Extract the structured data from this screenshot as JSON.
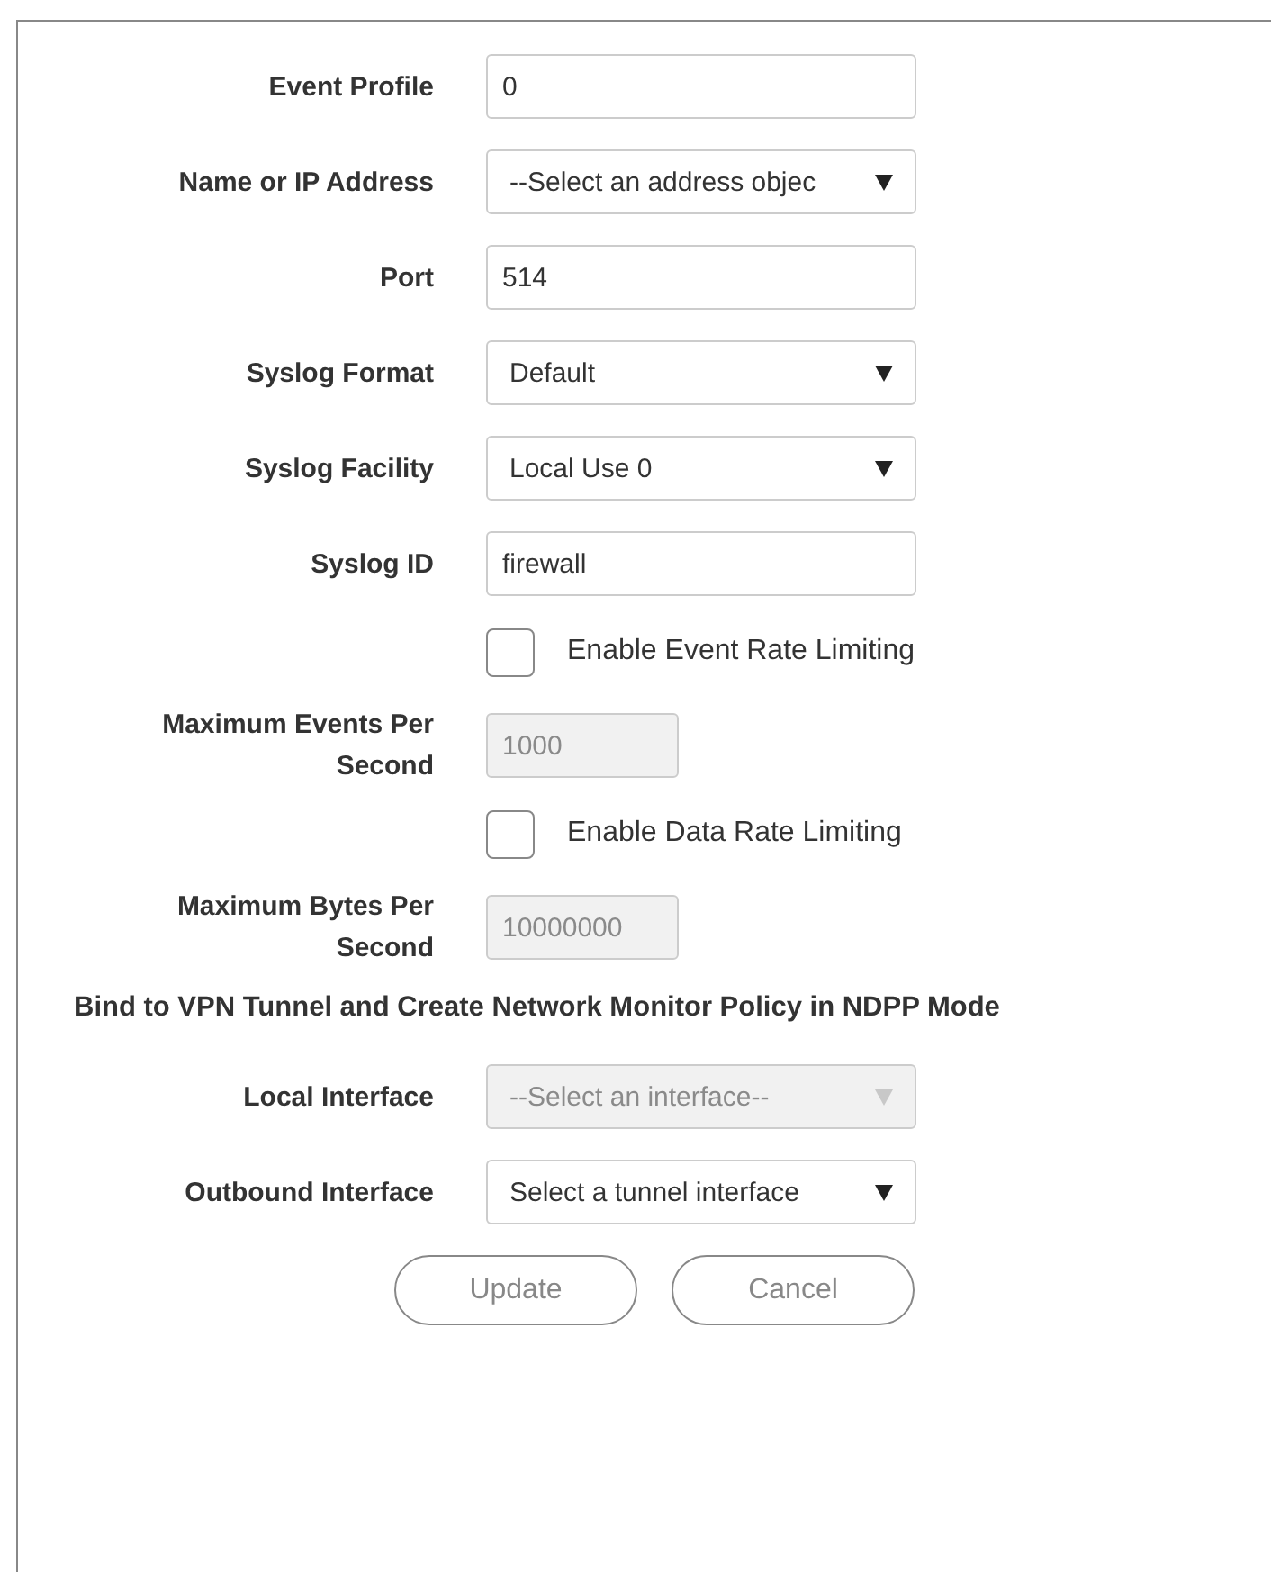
{
  "form": {
    "rows": [
      {
        "kind": "text",
        "label": "Event Profile",
        "value": "0",
        "disabled": false
      },
      {
        "kind": "select",
        "label": "Name or IP Address",
        "value": "--Select an address objec",
        "disabled": false
      },
      {
        "kind": "text",
        "label": "Port",
        "value": "514",
        "disabled": false
      },
      {
        "kind": "select",
        "label": "Syslog Format",
        "value": "Default",
        "disabled": false
      },
      {
        "kind": "select",
        "label": "Syslog Facility",
        "value": "Local Use 0",
        "disabled": false
      },
      {
        "kind": "text",
        "label": "Syslog ID",
        "value": "firewall",
        "disabled": false
      },
      {
        "kind": "checkbox",
        "label": "Enable Event Rate Limiting",
        "checked": false
      },
      {
        "kind": "short_text",
        "label": "Maximum Events Per Second",
        "value": "1000",
        "disabled": true
      },
      {
        "kind": "checkbox",
        "label": "Enable Data Rate Limiting",
        "checked": false
      },
      {
        "kind": "short_text",
        "label": "Maximum Bytes Per Second",
        "value": "10000000",
        "disabled": true
      },
      {
        "kind": "heading",
        "label": "Bind to VPN Tunnel and Create Network Monitor Policy in NDPP Mode"
      },
      {
        "kind": "select",
        "label": "Local Interface",
        "value": "--Select an interface--",
        "disabled": true
      },
      {
        "kind": "select",
        "label": "Outbound Interface",
        "value": "Select a tunnel interface",
        "disabled": false
      }
    ]
  },
  "buttons": [
    "Update",
    "Cancel"
  ]
}
